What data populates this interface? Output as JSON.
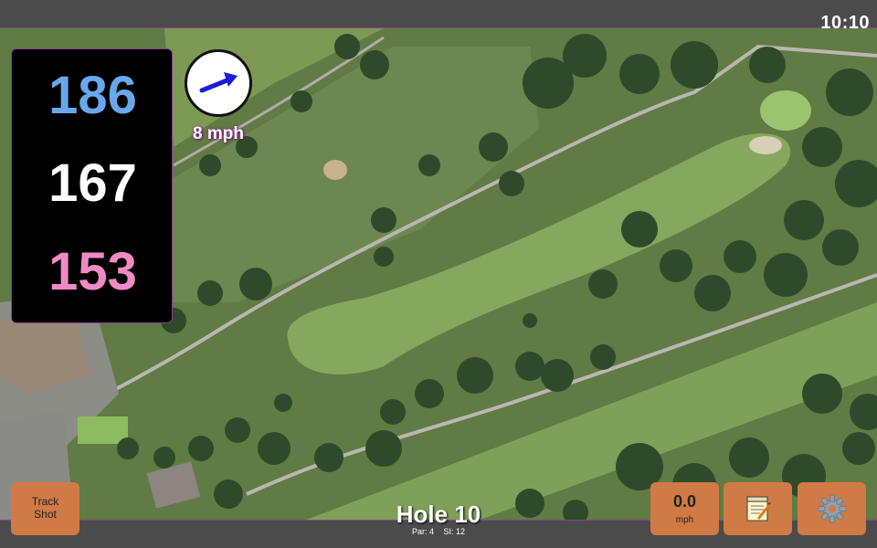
{
  "status": {
    "time": "10:10"
  },
  "distances": {
    "back": "186",
    "middle": "167",
    "front": "153",
    "back_color": "#6aa8ec",
    "middle_color": "#ffffff",
    "front_color": "#f08ac4"
  },
  "wind": {
    "speed_label": "8 mph",
    "arrow_icon": "wind-direction-arrow-icon",
    "arrow_color": "#1a1adf"
  },
  "hole": {
    "title": "Hole 10",
    "par": "Par: 4",
    "stroke_index": "SI: 12"
  },
  "buttons": {
    "track_shot": "Track\nShot",
    "speed_value": "0.0",
    "speed_unit": "mph",
    "notes_icon": "notepad-icon",
    "settings_icon": "gear-icon"
  },
  "colors": {
    "button": "#d07a45",
    "panel_border": "#8a3f8a",
    "bar": "#4b4b4b"
  }
}
